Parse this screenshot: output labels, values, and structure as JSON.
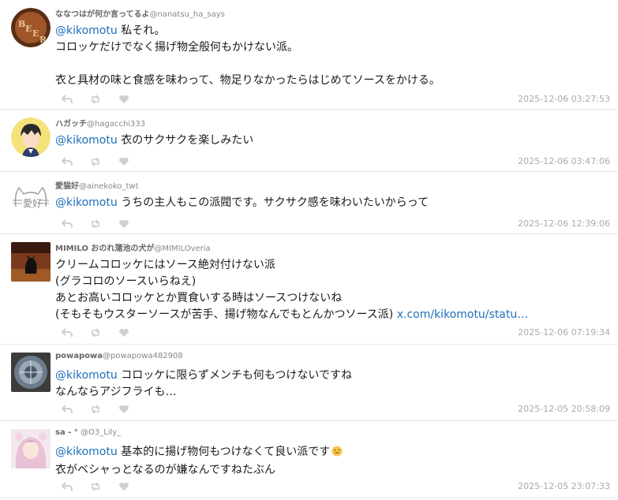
{
  "tweets": [
    {
      "name": "ななつはが何か言ってるよ",
      "handle": "@nanatsu_ha_says",
      "mention": "@kikomotu",
      "line1_rest": " 私それ。",
      "line2": "コロッケだけでなく揚げ物全般何もかけない派。",
      "line4": "衣と具材の味と食感を味わって、物足りなかったらはじめてソースをかける。",
      "time": "2025-12-06 03:27:53"
    },
    {
      "name": "ハガッチ",
      "handle": "@hagacchi333",
      "mention": "@kikomotu",
      "line1_rest": " 衣のサクサクを楽しみたい",
      "time": "2025-12-06 03:47:06"
    },
    {
      "name": "愛猫好",
      "handle": "@ainekoko_twt",
      "mention": "@kikomotu",
      "line1_rest": " うちの主人もこの派閥です。サクサク感を味わいたいからって",
      "time": "2025-12-06 12:39:06"
    },
    {
      "name": "MIMILO おのれ蒲池の犬が",
      "handle": "@MIMILOveria",
      "line1": "クリームコロッケにはソース絶対付けない派",
      "line2": "(グラコロのソースいらねえ)",
      "line3": "あとお高いコロッケとか買食いする時はソースつけないね",
      "line4": "(そもそもウスターソースが苦手、揚げ物なんでもとんかつソース派) ",
      "link": "x.com/kikomotu/statu…",
      "time": "2025-12-06 07:19:34"
    },
    {
      "name": "powapowa",
      "handle": "@powapowa482908",
      "mention": "@kikomotu",
      "line1_rest": " コロッケに限らずメンチも何もつけないですね",
      "line2": "なんならアジフライも…",
      "time": "2025-12-05 20:58:09"
    },
    {
      "name": "sa - °",
      "handle": "@O3_Lily_",
      "mention": "@kikomotu",
      "line1_rest": " 基本的に揚げ物何もつけなくて良い派です",
      "line2": "衣がベシャっとなるのが嫌なんですねたぶん",
      "time": "2025-12-05 23:07:33"
    }
  ]
}
